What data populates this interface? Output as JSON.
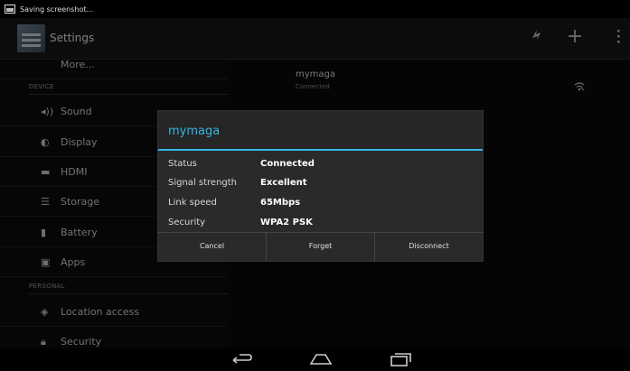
{
  "statusbar": {
    "text": "Saving screenshot..."
  },
  "actionbar": {
    "title": "Settings",
    "icons": [
      "wifi-toggle-icon",
      "add-icon",
      "overflow-menu-icon"
    ]
  },
  "sidebar": {
    "more_label": "More...",
    "device_header": "DEVICE",
    "personal_header": "PERSONAL",
    "items": [
      {
        "label": "Sound",
        "icon": "sound-icon"
      },
      {
        "label": "Display",
        "icon": "display-icon"
      },
      {
        "label": "HDMI",
        "icon": "hdmi-icon"
      },
      {
        "label": "Storage",
        "icon": "storage-icon"
      },
      {
        "label": "Battery",
        "icon": "battery-icon"
      },
      {
        "label": "Apps",
        "icon": "apps-icon"
      },
      {
        "label": "Location access",
        "icon": "location-icon"
      },
      {
        "label": "Security",
        "icon": "security-icon"
      }
    ]
  },
  "wifi": {
    "network_name": "mymaga",
    "status": "Connected"
  },
  "dialog": {
    "title": "mymaga",
    "rows": [
      {
        "key": "Status",
        "value": "Connected"
      },
      {
        "key": "Signal strength",
        "value": "Excellent"
      },
      {
        "key": "Link speed",
        "value": "65Mbps"
      },
      {
        "key": "Security",
        "value": "WPA2 PSK"
      }
    ],
    "buttons": {
      "cancel": "Cancel",
      "forget": "Forget",
      "disconnect": "Disconnect"
    }
  },
  "navbar": {
    "icons": [
      "back-icon",
      "home-icon",
      "recent-apps-icon"
    ]
  },
  "colors": {
    "accent": "#33b5e5",
    "background": "#000000"
  }
}
